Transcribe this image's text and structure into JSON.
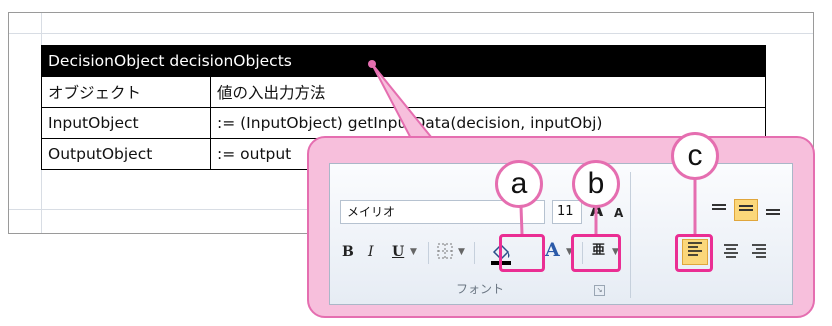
{
  "table": {
    "header": "DecisionObject decisionObjects",
    "rows": [
      {
        "label": "オブジェクト",
        "value": "値の入出力方法"
      },
      {
        "label": "InputObject",
        "value": ":= (InputObject) getInputData(decision, inputObj)"
      },
      {
        "label": "OutputObject",
        "value": ":= output"
      }
    ]
  },
  "ribbon": {
    "font_name": "メイリオ",
    "font_size": "11",
    "group_label": "フォント",
    "bold": "B",
    "italic": "I",
    "underline": "U",
    "font_color_letter": "A",
    "grow_font": "A",
    "shrink_font": "A",
    "phonetic_glyph": "亜"
  },
  "callouts": {
    "a": "a",
    "b": "b",
    "c": "c"
  },
  "colors": {
    "callout_fill": "#f7bfdc",
    "callout_border": "#e56eb0",
    "highlight_border": "#ea2e93",
    "selected_orange": "#fbd77a"
  }
}
